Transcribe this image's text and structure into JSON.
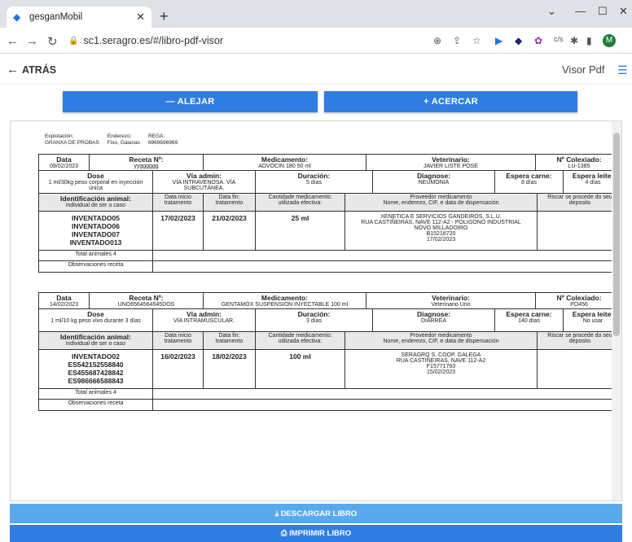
{
  "browser": {
    "tab_title": "gesganMobil",
    "url": "sc1.seragro.es/#/libro-pdf-visor",
    "avatar": "M"
  },
  "appbar": {
    "back": "ATRÁS",
    "title": "Visor Pdf"
  },
  "zoom": {
    "out": "—  ALEJAR",
    "in": "+  ACERCAR"
  },
  "header": {
    "l1": "Explotación:",
    "v1": "GRANXA DE PROBAS",
    "l2": "Enderezo:",
    "v2": "Fixo, Galanas",
    "l3": "REGA:",
    "v3": "6969696969"
  },
  "labels": {
    "data": "Data",
    "receta": "Receta Nº:",
    "medicamento": "Medicamento:",
    "veterinario": "Veterinario:",
    "colexiado": "Nº Colexiado:",
    "dose": "Dose",
    "via": "Vía admin:",
    "duracion": "Duración:",
    "diagnose": "Diagnose:",
    "carne": "Espera carne:",
    "leite": "Espera leite:",
    "ident": "Identificación animal:",
    "ident_sub": "individual de ser o caso",
    "inicio": "Data inicio tratamento",
    "fin": "Data fin: tratamento",
    "cantidade": "Cantidade medicamento: utilizada efectiva:",
    "proveedor": "Proveedor medicamento",
    "proveedor_sub": "Nome, enderezo, CIF, e data de dispensación",
    "riscar": "Riscar se procede do seu deposito",
    "total": "Total animales 4",
    "obs": "Observaciones receta"
  },
  "r1": {
    "data": "09/02/2023",
    "receta": "yygggggg",
    "medicamento": "ADVOCIN 180 50 ml",
    "veterinario": "JAVIER LISTE POSE",
    "colexiado": "LU-1385",
    "dose": "1 ml/30kg peso corporal en inyección única",
    "via": "VÍA INTRAVENOSA. VÍA SUBCUTÁNEA.",
    "duracion": "5 días",
    "diagnose": "NEUMONIA",
    "carne": "8 días",
    "leite": "4 días",
    "animals": [
      "INVENTADO05",
      "INVENTADO06",
      "INVENTADO07",
      "INVENTADO013"
    ],
    "inicio": "17/02/2023",
    "fin": "21/02/2023",
    "cantidade": "25 ml",
    "prov": [
      "XENETICA E SERVICIOS GANDEIROS, S.L.U.",
      "RUA CASTIÑEIRAS, NAVE 112-A2 - POLIGONO INDUSTRIAL",
      "NOVO MILLADOIRO",
      "B15218720",
      "17/02/2023"
    ]
  },
  "r2": {
    "data": "14/02/2023",
    "receta": "UNO6564564545DOS",
    "medicamento": "GENTAMOX SUSPENSION INYECTABLE 100 ml",
    "veterinario": "Veterinario Uno",
    "colexiado": "PO456",
    "dose": "1 ml/10 kg peso vivo durante 3 días",
    "via": "VÍA INTRAMUSCULAR.",
    "duracion": "3 días",
    "diagnose": "DIARREA",
    "carne": "140 días",
    "leite": "No usar",
    "animals": [
      "INVENTADO02",
      "ES542152558840",
      "ES455687428842",
      "ES986666588843"
    ],
    "inicio": "16/02/2023",
    "fin": "18/02/2023",
    "cantidade": "100 ml",
    "prov": [
      "SERAGRO S. COOP. GALEGA",
      "RUA CASTIÑEIRAS, NAVE 112-A2",
      "F15771793",
      "15/02/2023"
    ]
  },
  "footer": {
    "download": "⤓  DESCARGAR LIBRO",
    "print": "⎙  IMPRIMIR LIBRO"
  }
}
